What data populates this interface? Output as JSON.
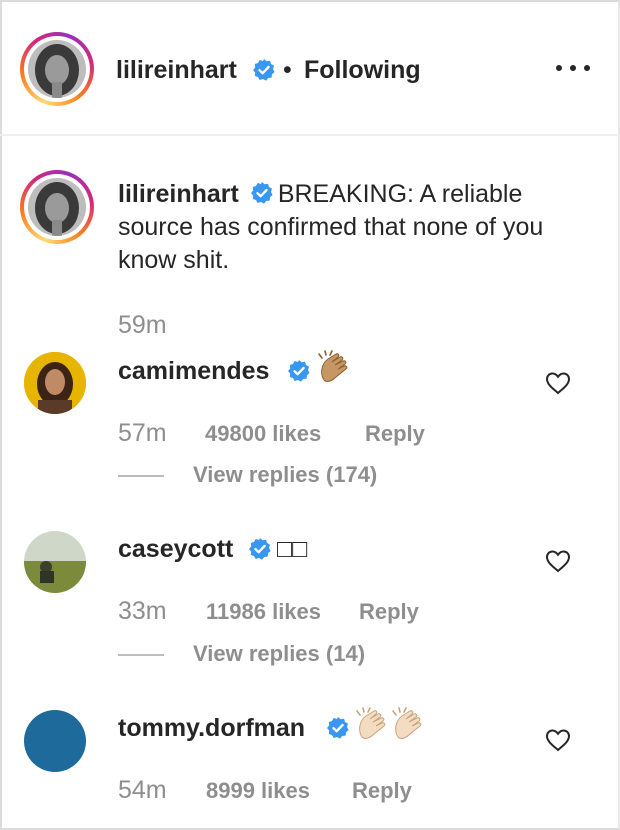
{
  "post_header": {
    "username": "lilireinhart",
    "separator": "•",
    "follow_status": "Following",
    "more_icon": "more-options-icon"
  },
  "caption": {
    "username": "lilireinhart",
    "text": "BREAKING: A reliable source has confirmed that none of you know shit.",
    "time": "59m"
  },
  "comments": [
    {
      "username": "camimendes",
      "emoji": "clapping-hands-medium-skin",
      "time": "57m",
      "likes": "49800 likes",
      "reply_label": "Reply",
      "view_replies": "View replies (174)"
    },
    {
      "username": "caseycott",
      "text": "□□",
      "time": "33m",
      "likes": "11986 likes",
      "reply_label": "Reply",
      "view_replies": "View replies (14)"
    },
    {
      "username": "tommy.dorfman",
      "emoji": "clapping-hands-light-skin x2",
      "time": "54m",
      "likes": "8999 likes",
      "reply_label": "Reply"
    }
  ],
  "colors": {
    "verified_blue": "#3897f0",
    "meta_gray": "#8e8e8e",
    "text_dark": "#262626",
    "tommy_avatar": "#1e6a9a",
    "cami_avatar_bg": "#e7b400"
  }
}
